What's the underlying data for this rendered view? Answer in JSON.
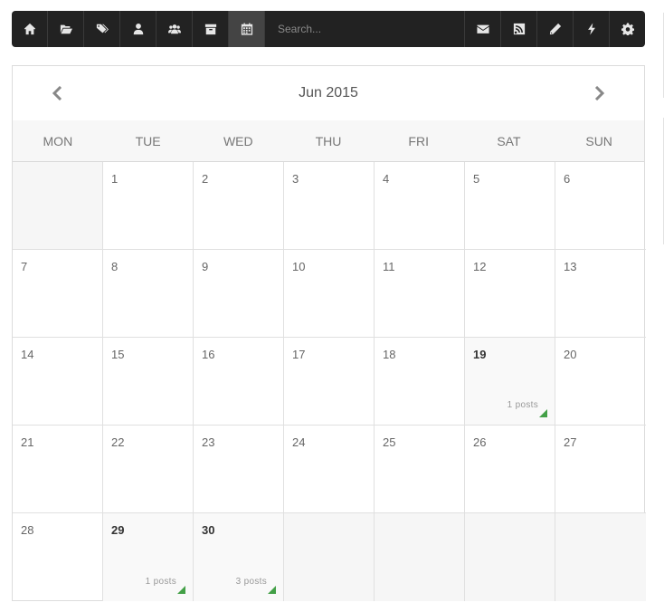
{
  "toolbar": {
    "left_icons": [
      "home-icon",
      "folder-open-icon",
      "tags-icon",
      "user-icon",
      "users-icon",
      "archive-icon",
      "calendar-icon"
    ],
    "active_icon": "calendar-icon",
    "search_placeholder": "Search...",
    "right_icons": [
      "envelope-icon",
      "rss-icon",
      "pencil-icon",
      "bolt-icon",
      "gear-icon"
    ]
  },
  "calendar": {
    "title": "Jun 2015",
    "weekdays": [
      "MON",
      "TUE",
      "WED",
      "THU",
      "FRI",
      "SAT",
      "SUN"
    ],
    "days": [
      {
        "day": ""
      },
      {
        "day": "1"
      },
      {
        "day": "2"
      },
      {
        "day": "3"
      },
      {
        "day": "4"
      },
      {
        "day": "5"
      },
      {
        "day": "6"
      },
      {
        "day": "7"
      },
      {
        "day": "8"
      },
      {
        "day": "9"
      },
      {
        "day": "10"
      },
      {
        "day": "11"
      },
      {
        "day": "12"
      },
      {
        "day": "13"
      },
      {
        "day": "14"
      },
      {
        "day": "15"
      },
      {
        "day": "16"
      },
      {
        "day": "17"
      },
      {
        "day": "18"
      },
      {
        "day": "19",
        "posts": "1 posts"
      },
      {
        "day": "20"
      },
      {
        "day": "21"
      },
      {
        "day": "22"
      },
      {
        "day": "23"
      },
      {
        "day": "24"
      },
      {
        "day": "25"
      },
      {
        "day": "26"
      },
      {
        "day": "27"
      },
      {
        "day": "28"
      },
      {
        "day": "29",
        "posts": "1 posts"
      },
      {
        "day": "30",
        "posts": "3 posts"
      },
      {
        "day": ""
      },
      {
        "day": ""
      },
      {
        "day": ""
      },
      {
        "day": ""
      }
    ]
  },
  "colors": {
    "toolbar_bg": "#222222",
    "posts_marker": "#43a047"
  }
}
